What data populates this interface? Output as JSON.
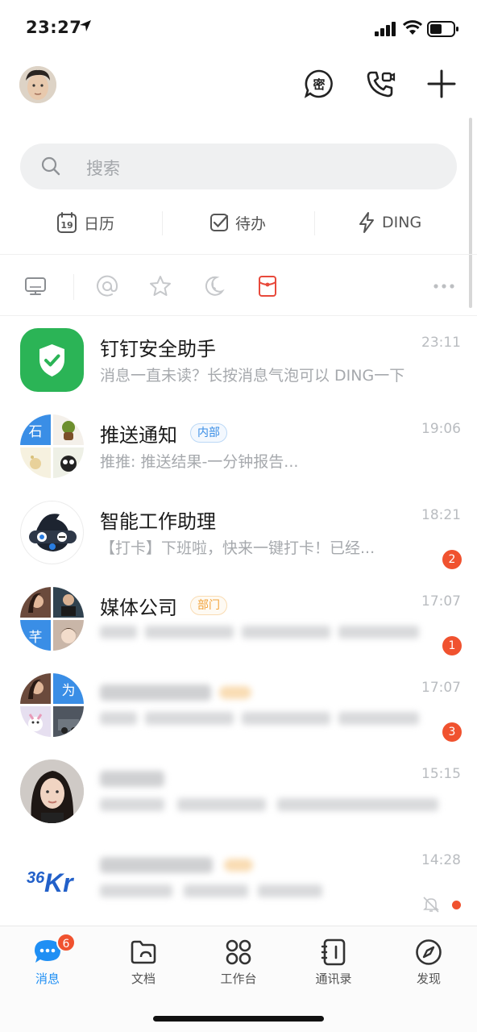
{
  "status_bar": {
    "time": "23:27"
  },
  "header": {
    "secret_chat_glyph": "密"
  },
  "search": {
    "placeholder": "搜索"
  },
  "quick_actions": [
    {
      "label": "日历",
      "icon": "calendar-icon",
      "calendar_day": "19"
    },
    {
      "label": "待办",
      "icon": "checkbox-icon"
    },
    {
      "label": "DING",
      "icon": "lightning-icon"
    }
  ],
  "filters": [
    "desktop-icon",
    "at-icon",
    "star-icon",
    "moon-clock-icon",
    "red-packet-icon",
    "more-icon"
  ],
  "chats": [
    {
      "name": "钉钉安全助手",
      "time": "23:11",
      "preview": "消息一直未读？长按消息气泡可以 DING一下"
    },
    {
      "name": "推送通知",
      "tag": "内部",
      "time": "19:06",
      "preview": "推推: 推送结果-一分钟报告...",
      "avatar_char": "石"
    },
    {
      "name": "智能工作助理",
      "time": "18:21",
      "preview": "【打卡】下班啦，快来一键打卡！已经...",
      "badge": "2"
    },
    {
      "name": "媒体公司",
      "tag": "部门",
      "time": "17:07",
      "preview": "",
      "badge": "1",
      "avatar_char": "芊"
    },
    {
      "name": "",
      "time": "17:07",
      "preview": "",
      "badge": "3",
      "avatar_char": "为"
    },
    {
      "name": "",
      "time": "15:15",
      "preview": ""
    },
    {
      "name": "",
      "time": "14:28",
      "preview": "",
      "avatar_logo": "36Kr"
    }
  ],
  "tabs": [
    {
      "label": "消息",
      "badge": "6"
    },
    {
      "label": "文档"
    },
    {
      "label": "工作台"
    },
    {
      "label": "通讯录"
    },
    {
      "label": "发现"
    }
  ],
  "colors": {
    "accent": "#1f8ff4",
    "badge": "#f0522f",
    "shield_green": "#2bb456",
    "dept_tag": "#f3a33a"
  }
}
